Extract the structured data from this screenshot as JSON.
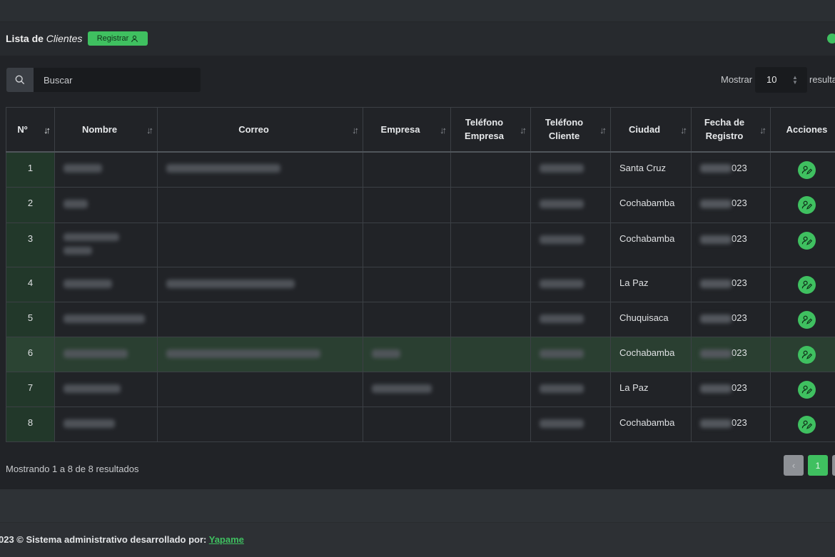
{
  "header": {
    "title_prefix": "Lista de",
    "title_em": "Clientes",
    "register_label": "Registrar"
  },
  "toolbar": {
    "search_placeholder": "Buscar",
    "show_label": "Mostrar",
    "page_size": "10",
    "results_label": "resulta"
  },
  "table": {
    "columns": [
      "Nº",
      "Nombre",
      "Correo",
      "Empresa",
      "Teléfono Empresa",
      "Teléfono Cliente",
      "Ciudad",
      "Fecha de Registro",
      "Acciones"
    ],
    "rows": [
      {
        "n": "1",
        "ciudad": "Santa Cruz",
        "fecha": "023"
      },
      {
        "n": "2",
        "ciudad": "Cochabamba",
        "fecha": "023"
      },
      {
        "n": "3",
        "ciudad": "Cochabamba",
        "fecha": "023"
      },
      {
        "n": "4",
        "ciudad": "La Paz",
        "fecha": "023"
      },
      {
        "n": "5",
        "ciudad": "Chuquisaca",
        "fecha": "023"
      },
      {
        "n": "6",
        "ciudad": "Cochabamba",
        "fecha": "023"
      },
      {
        "n": "7",
        "ciudad": "La Paz",
        "fecha": "023"
      },
      {
        "n": "8",
        "ciudad": "Cochabamba",
        "fecha": "023"
      }
    ],
    "highlighted_row": 6
  },
  "pagination": {
    "info": "Mostrando 1 a 8 de 8 resultados",
    "prev": "‹",
    "current": "1"
  },
  "footer": {
    "text": "023 © Sistema administrativo desarrollado por:",
    "link": "Yapame"
  },
  "colors": {
    "accent": "#3fc060",
    "background": "#212327",
    "highlight_row": "#2a3f31"
  }
}
